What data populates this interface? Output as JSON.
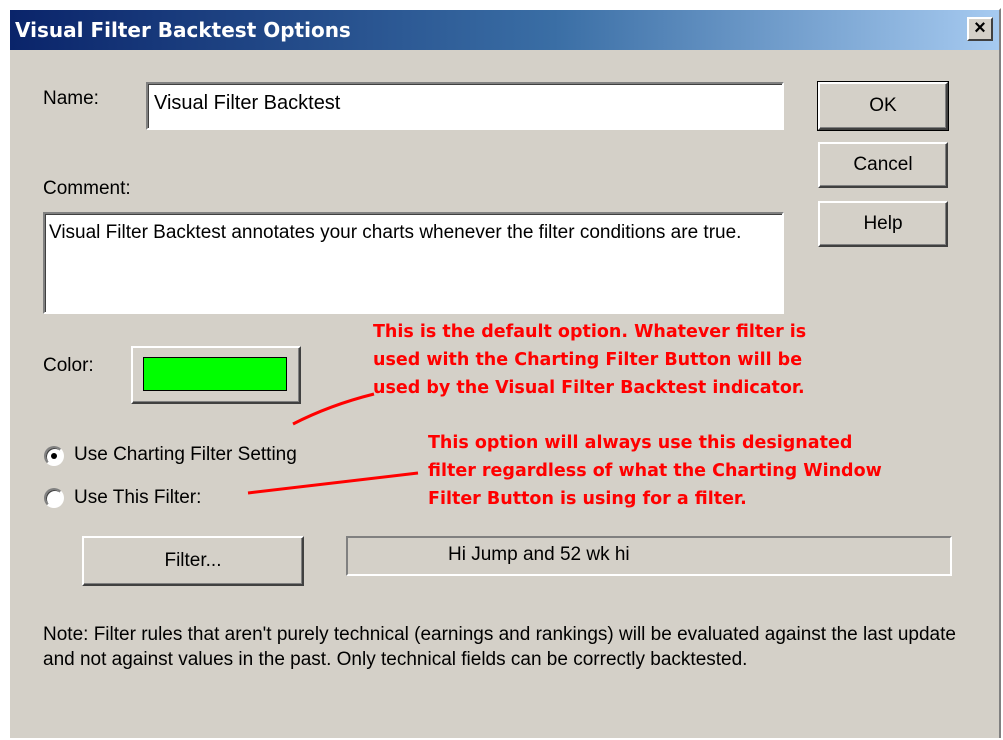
{
  "window": {
    "title": "Visual Filter Backtest Options",
    "close_glyph": "×"
  },
  "fields": {
    "name_label": "Name:",
    "name_value": "Visual Filter Backtest",
    "comment_label": "Comment:",
    "comment_value": "Visual Filter Backtest annotates your charts whenever the filter conditions are true.",
    "color_label": "Color:",
    "color_value": "#00ff00"
  },
  "buttons": {
    "ok": "OK",
    "cancel": "Cancel",
    "help": "Help",
    "filter": "Filter..."
  },
  "options": {
    "use_charting": "Use Charting Filter Setting",
    "use_this": "Use This Filter:",
    "selected": "use_charting"
  },
  "filter_name": "Hi Jump and 52 wk hi",
  "annotations": {
    "default_option": [
      "This is the default option.  Whatever filter is",
      "used with the Charting Filter Button will be",
      "used by the Visual Filter Backtest indicator."
    ],
    "designated_option": [
      "This option will always use this designated",
      "filter regardless of what the Charting Window",
      "Filter Button is using for a filter."
    ]
  },
  "note": "Note: Filter rules that aren't purely technical (earnings and rankings) will be evaluated against the last update and not against values in the past.  Only technical fields can be correctly backtested.",
  "colors": {
    "annotation": "#ff0000",
    "dialog_bg": "#d4d0c8",
    "title_gradient_start": "#0a246a",
    "title_gradient_end": "#a6caf0"
  }
}
